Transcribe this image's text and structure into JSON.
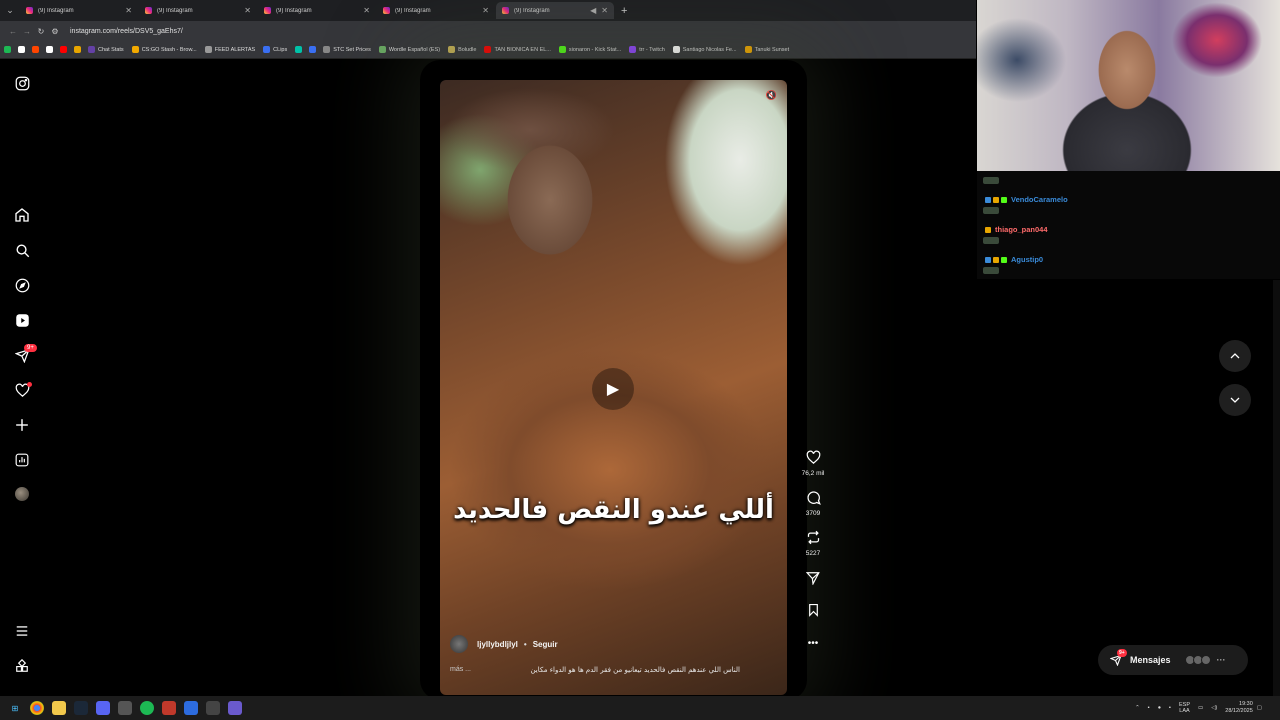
{
  "browser": {
    "tabs": [
      {
        "title": "(9) Instagram"
      },
      {
        "title": "(9) Instagram"
      },
      {
        "title": "(9) Instagram"
      },
      {
        "title": "(9) Instagram"
      },
      {
        "title": "(9) Instagram",
        "active": true
      }
    ],
    "new_tab_label": "+",
    "url": "instagram.com/reels/DSV5_gaEhs7/",
    "bookmarks": [
      {
        "label": "",
        "color": "#1db954"
      },
      {
        "label": "",
        "color": "#ffffff"
      },
      {
        "label": "",
        "color": "#ff4500"
      },
      {
        "label": "",
        "color": "#ffffff"
      },
      {
        "label": "",
        "color": "#ff0000"
      },
      {
        "label": "",
        "color": "#e8a600"
      },
      {
        "label": "Chat Stats",
        "color": "#6441a5"
      },
      {
        "label": "CS:GO Stash - Brow...",
        "color": "#f2a900"
      },
      {
        "label": "FEED ALERTAS",
        "color": "#999999"
      },
      {
        "label": "CLips",
        "color": "#3a6ff2"
      },
      {
        "label": "",
        "color": "#00c2a8"
      },
      {
        "label": "",
        "color": "#3a6ff2"
      },
      {
        "label": "STC Set Prices",
        "color": "#888888"
      },
      {
        "label": "Wordle Español (ES)",
        "color": "#6aaa64"
      },
      {
        "label": "Boludle",
        "color": "#c9b458"
      },
      {
        "label": "TAN BIONICA EN EL...",
        "color": "#ff0000"
      },
      {
        "label": "sionaron - Kick Stat...",
        "color": "#53fc18"
      },
      {
        "label": "trr - Twitch",
        "color": "#9146ff"
      },
      {
        "label": "Santiago Nicolas Fe...",
        "color": "#ffffff"
      },
      {
        "label": "Tanuki Sunset",
        "color": "#f2a900"
      }
    ]
  },
  "sidebar": {
    "notifications_badge": "9+"
  },
  "reel": {
    "overlay_text": "أللي عندو النقص فالحديد",
    "author": "ljyllybdljlyl",
    "separator": "•",
    "follow_label": "Seguir",
    "more_label": "más ...",
    "description": "الناس اللي عندهم النقص فالحديد تيعانيو من فقر الدم ها هو الدواء مكاين"
  },
  "actions": {
    "likes": "76,2 mil",
    "comments": "3709",
    "reposts": "5227"
  },
  "messages": {
    "label": "Mensajes",
    "badge": "9+"
  },
  "stream_chat": [
    {
      "name": "VendoCaramelo",
      "color": "#3a8bd9"
    },
    {
      "name": "thiago_pan044",
      "color": "#ff6b6b"
    },
    {
      "name": "Agustip0",
      "color": "#3a8bd9"
    }
  ],
  "taskbar": {
    "lang_top": "ESP",
    "lang_bottom": "LAA",
    "time": "19:30",
    "date": "28/12/2025"
  },
  "colors": {
    "instagram_red": "#ff3040",
    "background": "#000000"
  }
}
